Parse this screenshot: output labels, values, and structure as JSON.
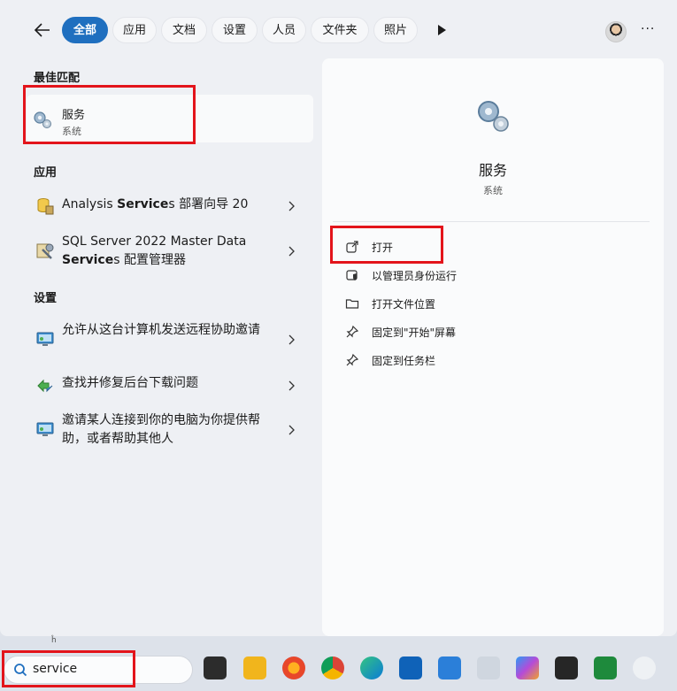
{
  "filters": {
    "tabs": [
      {
        "label": "全部",
        "active": true
      },
      {
        "label": "应用"
      },
      {
        "label": "文档"
      },
      {
        "label": "设置"
      },
      {
        "label": "人员"
      },
      {
        "label": "文件夹"
      },
      {
        "label": "照片"
      }
    ],
    "more": "···"
  },
  "best_match": {
    "title": "最佳匹配",
    "name": "服务",
    "type": "系统"
  },
  "apps": {
    "title": "应用",
    "items": [
      {
        "pre": "Analysis ",
        "bold": "Service",
        "post": "s 部署向导 20"
      },
      {
        "pre": "SQL Server 2022 Master Data ",
        "bold": "Service",
        "post": "s 配置管理器"
      }
    ]
  },
  "settings": {
    "title": "设置",
    "items": [
      {
        "label": "允许从这台计算机发送远程协助邀请"
      },
      {
        "label": "查找并修复后台下载问题"
      },
      {
        "label": "邀请某人连接到你的电脑为你提供帮助，或者帮助其他人"
      }
    ]
  },
  "detail": {
    "name": "服务",
    "type": "系统",
    "actions": [
      {
        "label": "打开"
      },
      {
        "label": "以管理员身份运行"
      },
      {
        "label": "打开文件位置"
      },
      {
        "label": "固定到\"开始\"屏幕"
      },
      {
        "label": "固定到任务栏"
      }
    ]
  },
  "taskbar": {
    "search_value": "service",
    "small_glyph": "ĥ"
  },
  "colors": {
    "accent": "#1f6fbf",
    "highlight": "#e3141b"
  }
}
